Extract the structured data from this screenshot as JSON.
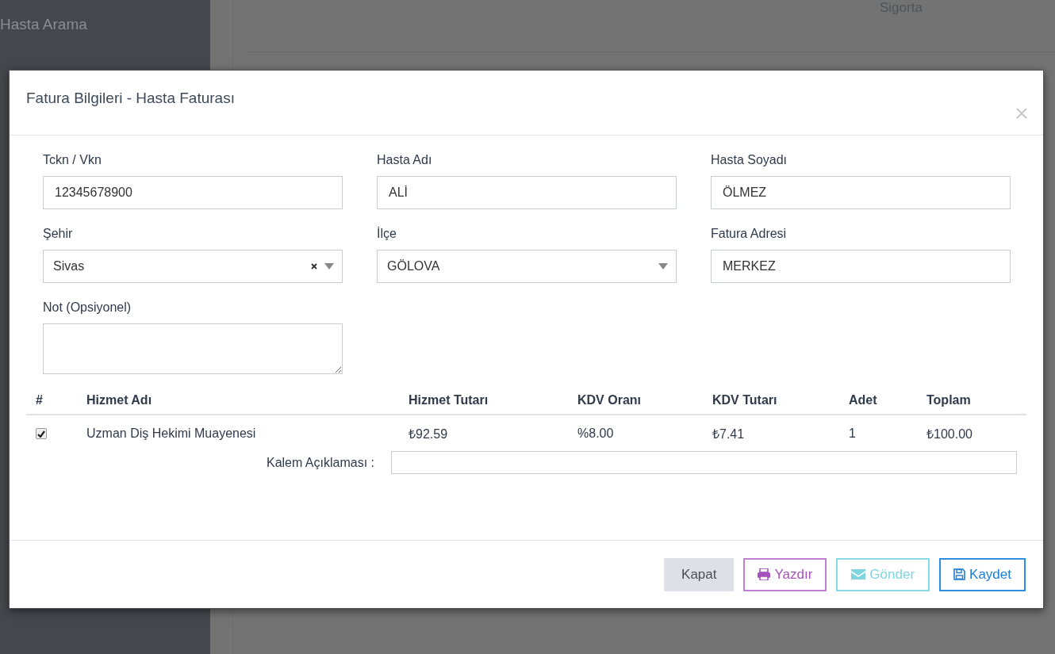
{
  "sidebar": {
    "items": [
      "Hasta Arama"
    ]
  },
  "page": {
    "column_header": "Sigorta"
  },
  "modal": {
    "title": "Fatura Bilgileri - Hasta Faturası",
    "fields": [
      {
        "label": "Tckn / Vkn",
        "value": "12345678900",
        "kind": "text"
      },
      {
        "label": "Hasta Adı",
        "value": "ALİ",
        "kind": "text"
      },
      {
        "label": "Hasta Soyadı",
        "value": "ÖLMEZ",
        "kind": "text"
      },
      {
        "label": "Şehir",
        "value": "Sivas",
        "kind": "select",
        "clearable": true
      },
      {
        "label": "İlçe",
        "value": "GÖLOVA",
        "kind": "select",
        "clearable": false
      },
      {
        "label": "Fatura Adresi",
        "value": "MERKEZ",
        "kind": "text"
      },
      {
        "label": "Not (Opsiyonel)",
        "kind": "textarea"
      }
    ],
    "table": {
      "columns": [
        "#",
        "Hizmet Adı",
        "Hizmet Tutarı",
        "KDV Oranı",
        "KDV Tutarı",
        "Adet",
        "Toplam"
      ],
      "rows": [
        {
          "checked": true,
          "cells": [
            "",
            "Uzman Diş Hekimi Muayenesi",
            "₺92.59",
            "%8.00",
            "₺7.41",
            "1",
            "₺100.00"
          ],
          "note_label": "Kalem Açıklaması :"
        }
      ]
    },
    "buttons": [
      {
        "label": "Kapat",
        "kind": "close"
      },
      {
        "label": "Yazdır",
        "kind": "print"
      },
      {
        "label": "Gönder",
        "kind": "send"
      },
      {
        "label": "Kaydet",
        "kind": "save"
      }
    ]
  }
}
